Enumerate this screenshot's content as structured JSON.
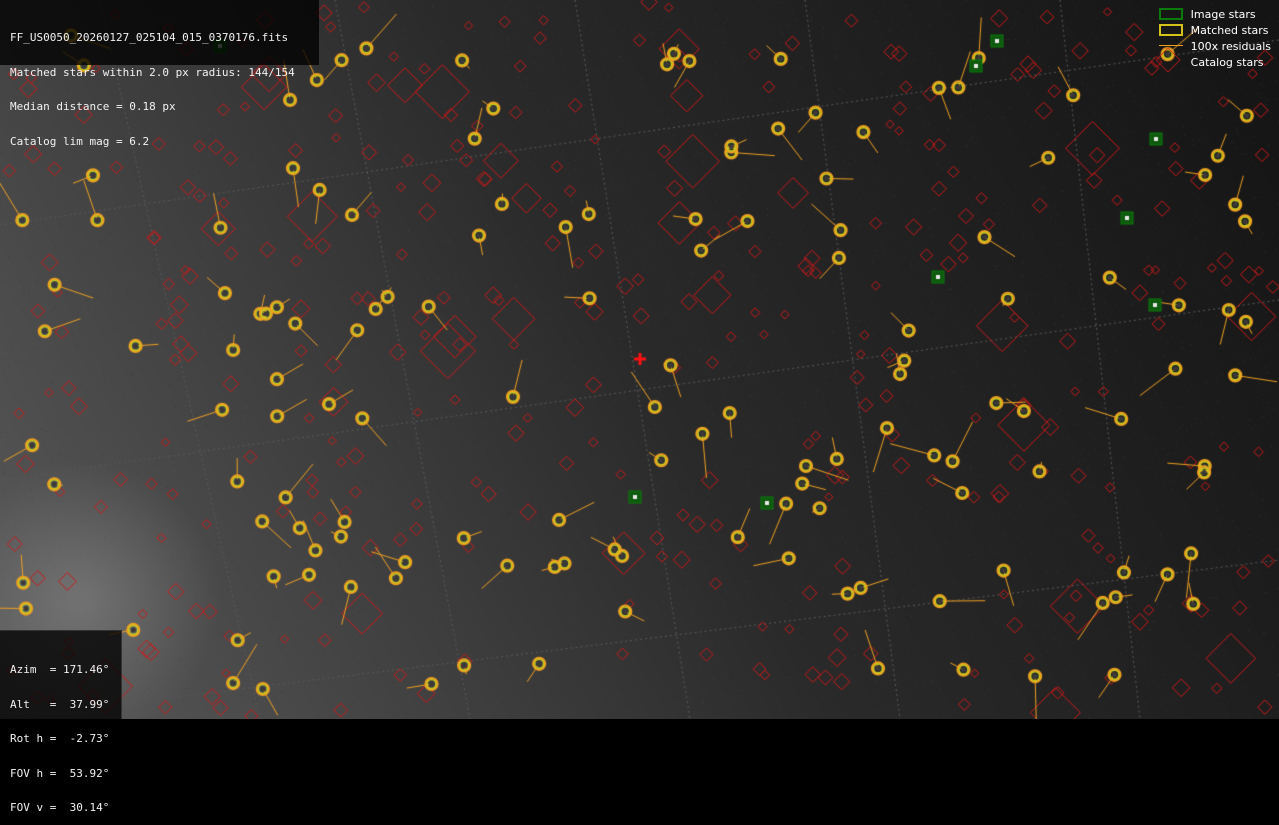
{
  "info": {
    "filename": "FF_US0050_20260127_025104_015_0370176.fits",
    "matched": "Matched stars within 2.0 px radius: 144/154",
    "median": "Median distance = 0.18 px",
    "catalog": "Catalog lim mag = 6.2"
  },
  "pointing": {
    "azim": "Azim  = 171.46°",
    "alt": "Alt   =  37.99°",
    "rot": "Rot h =  -2.73°",
    "fov_h": "FOV h =  53.92°",
    "fov_v": "FOV v =  30.14°"
  },
  "legend": {
    "image_stars": "Image stars",
    "matched_stars": "Matched stars",
    "residuals": "100x residuals",
    "catalog_stars": "Catalog stars"
  },
  "colors": {
    "image_star": "#0a7a0a",
    "matched_star": "#c8cc20",
    "residual": "#f0a020",
    "catalog": "#d01818",
    "center_cross": "#ff1010",
    "grid": "#5a5a5a"
  },
  "icons": {
    "center": "red-plus-cross-icon"
  }
}
